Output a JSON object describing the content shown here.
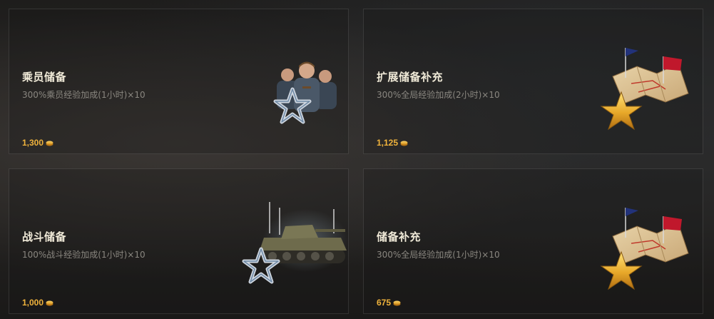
{
  "colors": {
    "price": "#f0b33c",
    "title": "#f0ead8",
    "description": "#8a8780"
  },
  "cards": [
    {
      "title": "乘员储备",
      "description": "300%乘员经验加成(1小时)×10",
      "price": "1,300",
      "icon": "crew-silver-star-icon"
    },
    {
      "title": "扩展储备补充",
      "description": "300%全局经验加成(2小时)×10",
      "price": "1,125",
      "icon": "map-gold-star-icon"
    },
    {
      "title": "战斗储备",
      "description": "100%战斗经验加成(1小时)×10",
      "price": "1,000",
      "icon": "tank-silver-star-icon"
    },
    {
      "title": "储备补充",
      "description": "300%全局经验加成(1小时)×10",
      "price": "675",
      "icon": "map-gold-star-icon"
    }
  ]
}
